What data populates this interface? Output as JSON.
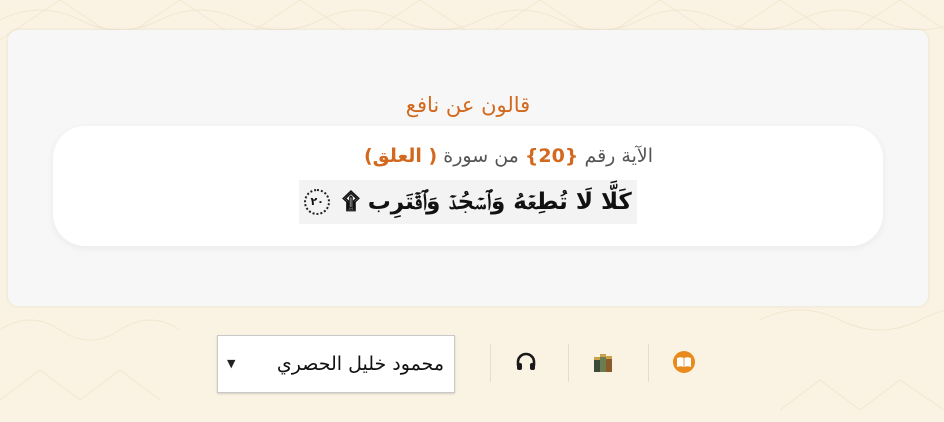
{
  "narration": {
    "title": "قالون عن نافع"
  },
  "verse": {
    "prefix": "الآية رقم",
    "number": "{20}",
    "middle": "من سورة",
    "surah": "( العلق)",
    "text": "كَلَّا لَا تُطِعۡهُ وَٱسۡجُدۡ وَٱقۡتَرِب ۩",
    "end_marker": "٢٠"
  },
  "toolbar": {
    "reciter_selected": "محمود خليل الحصري",
    "listen_icon": "headphones-icon",
    "books_icon": "books-icon",
    "read_icon": "open-book-icon"
  },
  "colors": {
    "accent": "#d2691e",
    "background": "#faf3e3",
    "panel": "#f7f7f7",
    "card": "#ffffff"
  }
}
